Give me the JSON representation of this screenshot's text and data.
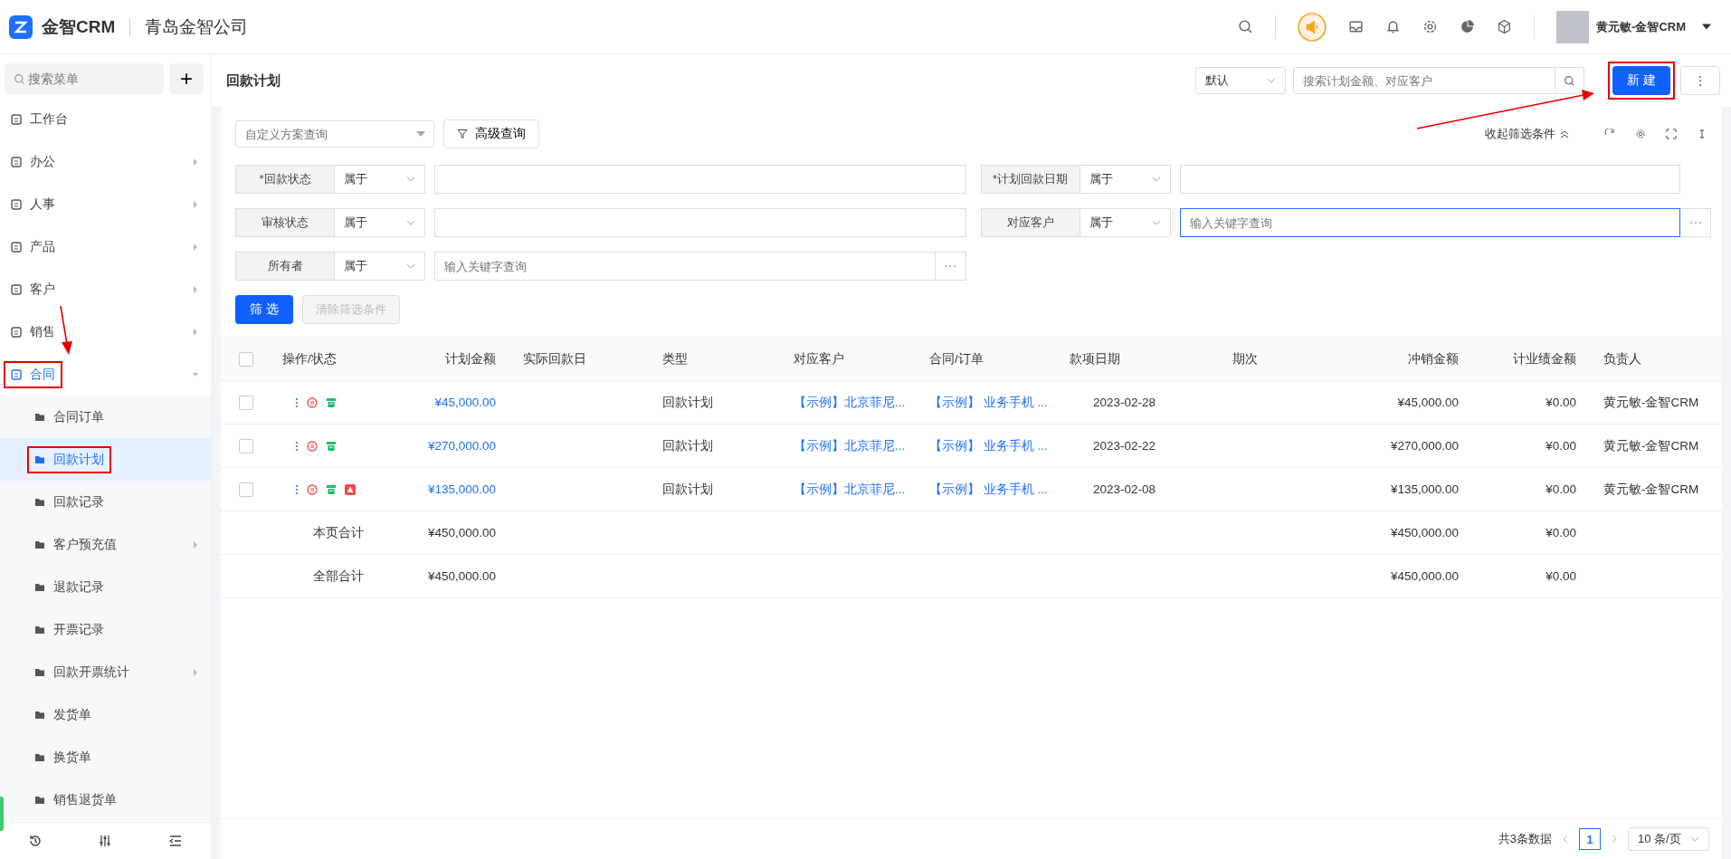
{
  "app": {
    "brand": "金智CRM",
    "company": "青岛金智公司",
    "user": "黄元敏-金智CRM"
  },
  "sidebar": {
    "search_placeholder": "搜索菜单",
    "add": "+",
    "items": [
      {
        "label": "工作台",
        "has_submenu": false,
        "selected": false,
        "highlighted": false
      },
      {
        "label": "办公",
        "has_submenu": true,
        "selected": false,
        "highlighted": false
      },
      {
        "label": "人事",
        "has_submenu": true,
        "selected": false,
        "highlighted": false
      },
      {
        "label": "产品",
        "has_submenu": true,
        "selected": false,
        "highlighted": false
      },
      {
        "label": "客户",
        "has_submenu": true,
        "selected": false,
        "highlighted": false
      },
      {
        "label": "销售",
        "has_submenu": true,
        "selected": false,
        "highlighted": false
      },
      {
        "label": "合同",
        "has_submenu": true,
        "selected": true,
        "highlighted": true,
        "expanded": true,
        "children": [
          {
            "label": "合同订单",
            "has_submenu": false,
            "selected": false,
            "highlighted": false
          },
          {
            "label": "回款计划",
            "has_submenu": false,
            "selected": true,
            "highlighted": true
          },
          {
            "label": "回款记录",
            "has_submenu": false,
            "selected": false,
            "highlighted": false
          },
          {
            "label": "客户预充值",
            "has_submenu": true,
            "selected": false,
            "highlighted": false
          },
          {
            "label": "退款记录",
            "has_submenu": false,
            "selected": false,
            "highlighted": false
          },
          {
            "label": "开票记录",
            "has_submenu": false,
            "selected": false,
            "highlighted": false
          },
          {
            "label": "回款开票统计",
            "has_submenu": true,
            "selected": false,
            "highlighted": false
          },
          {
            "label": "发货单",
            "has_submenu": false,
            "selected": false,
            "highlighted": false
          },
          {
            "label": "换货单",
            "has_submenu": false,
            "selected": false,
            "highlighted": false
          },
          {
            "label": "销售退货单",
            "has_submenu": false,
            "selected": false,
            "highlighted": false
          }
        ]
      }
    ]
  },
  "page": {
    "title": "回款计划",
    "view_select": "默认",
    "search_placeholder": "搜索计划金额、对应客户",
    "new_button": "新 建",
    "new_highlighted": true,
    "more": "⋮"
  },
  "filters": {
    "scheme_placeholder": "自定义方案查询",
    "advanced": "高级查询",
    "collapse": "收起筛选条件",
    "fields": [
      {
        "label": "*回款状态",
        "operator": "属于",
        "kind": "select",
        "focused": false
      },
      {
        "label": "*计划回款日期",
        "operator": "属于",
        "kind": "select",
        "focused": false
      },
      {
        "label": "审核状态",
        "operator": "属于",
        "kind": "select",
        "focused": false
      },
      {
        "label": "对应客户",
        "operator": "属于",
        "kind": "lookup",
        "placeholder": "输入关键字查询",
        "focused": true
      },
      {
        "label": "所有者",
        "operator": "属于",
        "kind": "lookup",
        "placeholder": "输入关键字查询",
        "focused": false
      }
    ],
    "filter_button": "筛 选",
    "clear_button": "清除筛选条件"
  },
  "table": {
    "all_checked": false,
    "columns": [
      "操作/状态",
      "计划金额",
      "实际回款日",
      "类型",
      "对应客户",
      "合同/订单",
      "款项日期",
      "期次",
      "冲销金额",
      "计业绩金额",
      "负责人"
    ],
    "rows": [
      {
        "checked": false,
        "flagged": false,
        "amount": "¥45,000.00",
        "actual_date": "",
        "type": "回款计划",
        "customer": "【示例】北京菲尼...",
        "contract": "【示例】 业务手机 ...",
        "date": "2023-02-28",
        "period": "",
        "writeoff": "¥45,000.00",
        "performance": "¥0.00",
        "owner": "黄元敏-金智CRM"
      },
      {
        "checked": false,
        "flagged": false,
        "amount": "¥270,000.00",
        "actual_date": "",
        "type": "回款计划",
        "customer": "【示例】北京菲尼...",
        "contract": "【示例】 业务手机 ...",
        "date": "2023-02-22",
        "period": "",
        "writeoff": "¥270,000.00",
        "performance": "¥0.00",
        "owner": "黄元敏-金智CRM"
      },
      {
        "checked": false,
        "flagged": true,
        "amount": "¥135,000.00",
        "actual_date": "",
        "type": "回款计划",
        "customer": "【示例】北京菲尼...",
        "contract": "【示例】 业务手机 ...",
        "date": "2023-02-08",
        "period": "",
        "writeoff": "¥135,000.00",
        "performance": "¥0.00",
        "owner": "黄元敏-金智CRM"
      }
    ],
    "totals": [
      {
        "label": "本页合计",
        "amount": "¥450,000.00",
        "writeoff": "¥450,000.00",
        "performance": "¥0.00"
      },
      {
        "label": "全部合计",
        "amount": "¥450,000.00",
        "writeoff": "¥450,000.00",
        "performance": "¥0.00"
      }
    ]
  },
  "pagination": {
    "total": "共3条数据",
    "pages": [
      {
        "label": "1",
        "selected": true
      }
    ],
    "page_size": "10 条/页"
  }
}
